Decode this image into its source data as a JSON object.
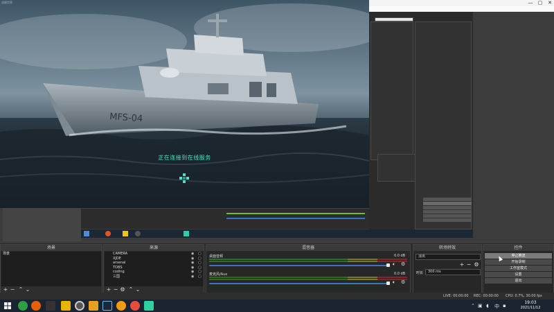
{
  "game": {
    "window_label": "战舰世界",
    "status_text": "正在连接到在线服务",
    "ship_marking": "MFS-04"
  },
  "titlebar": {
    "minimize": "—",
    "maximize": "▢",
    "close": "✕"
  },
  "scenes": {
    "title": "场景",
    "items": [
      {
        "label": "场景"
      }
    ]
  },
  "sources": {
    "title": "来源",
    "items": [
      {
        "label": "CAMERA"
      },
      {
        "label": "XJDE"
      },
      {
        "label": "arsenal"
      },
      {
        "label": "TOBS"
      },
      {
        "label": "coding"
      },
      {
        "label": "三国"
      }
    ]
  },
  "mixer": {
    "title": "混音器",
    "channels": [
      {
        "name": "桌面音频",
        "db": "0.0 dB"
      },
      {
        "name": "麦克风/Aux",
        "db": "0.0 dB"
      }
    ]
  },
  "transitions": {
    "title": "转场特效",
    "type_value": "淡出",
    "duration_label": "时长",
    "duration_value": "300 ms"
  },
  "controls": {
    "title": "控件",
    "buttons": [
      {
        "label": "停止推流"
      },
      {
        "label": "开始录制"
      },
      {
        "label": "工作室模式"
      },
      {
        "label": "设置"
      },
      {
        "label": "退出"
      }
    ]
  },
  "statusbar": {
    "live": "LIVE: 00:00:00",
    "rec": "REC: 00:00:00",
    "cpu": "CPU: 0.7%, 30.00 fps"
  },
  "taskbar": {
    "time": "19:03",
    "date": "2021/11/12"
  },
  "colors": {
    "accent": "#4fe0c4",
    "slider": "#3b73c4",
    "selection": "#4d5a68"
  }
}
